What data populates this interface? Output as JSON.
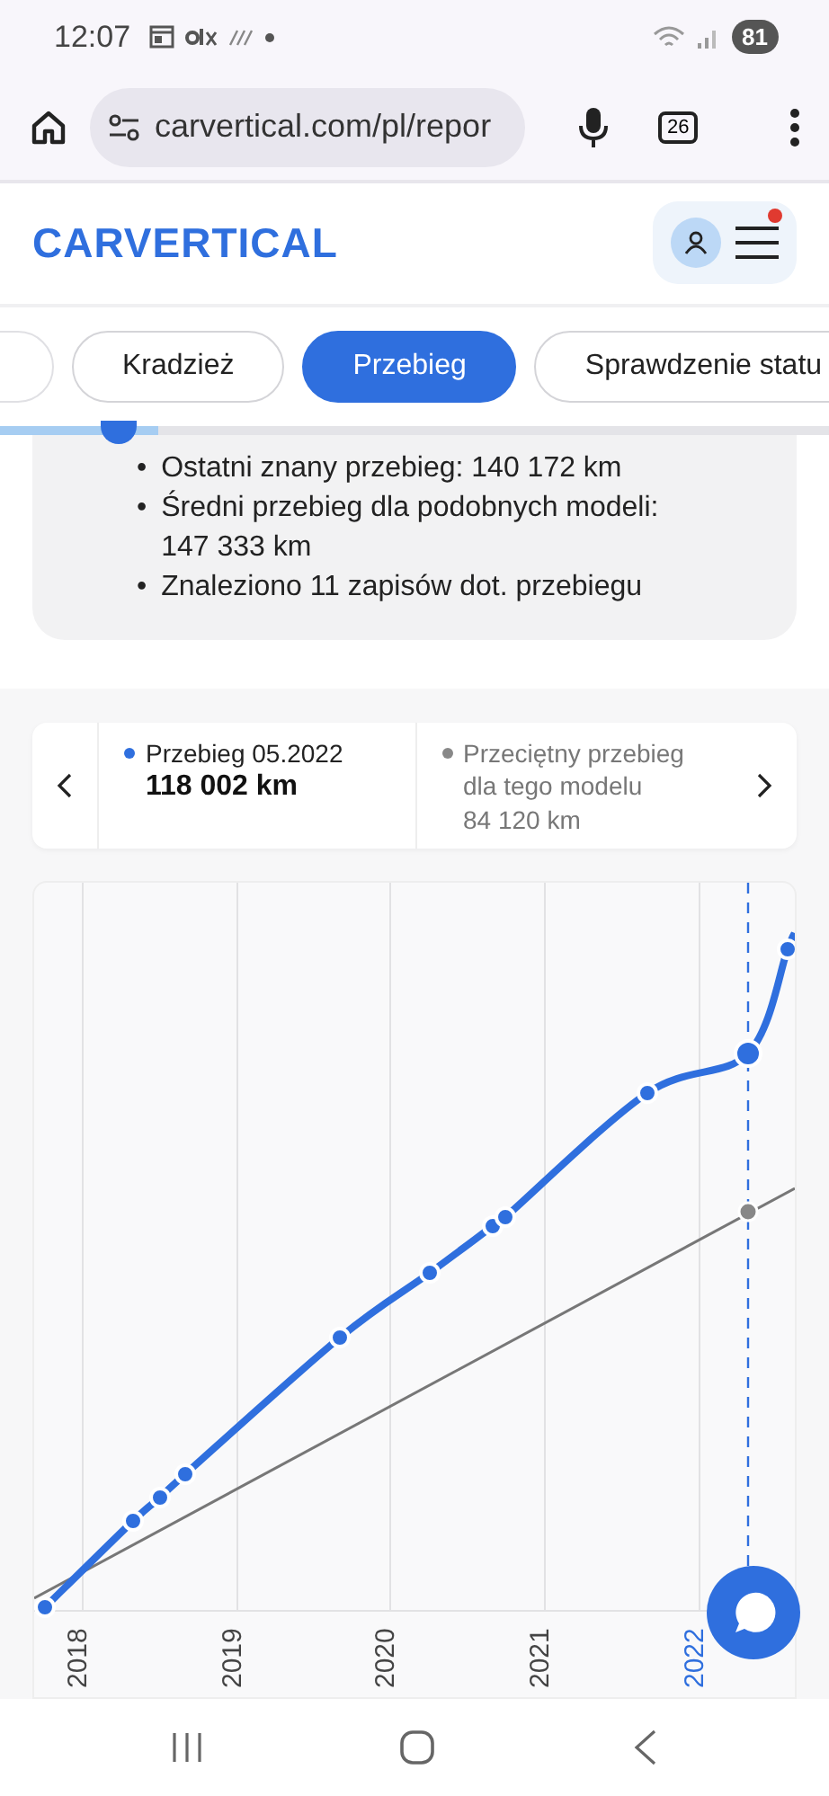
{
  "status_bar": {
    "time": "12:07",
    "battery": "81"
  },
  "browser": {
    "url": "carvertical.com/pl/repor",
    "tab_count": "26"
  },
  "header": {
    "logo": "CARVERTICAL",
    "menu_notification": true
  },
  "tabs": [
    {
      "label": "Kradzież",
      "selected": false
    },
    {
      "label": "Przebieg",
      "selected": true
    },
    {
      "label": "Sprawdzenie statu",
      "selected": false
    }
  ],
  "scroll_progress": {
    "level": 0.19
  },
  "summary": {
    "items": [
      {
        "marker": "•",
        "text": "Ostatni znany przebieg: 140 172 km"
      },
      {
        "marker": "•",
        "text": "Średni przebieg dla podobnych modeli: 147 333 km"
      },
      {
        "marker": "•",
        "text": "Znaleziono 11 zapisów dot. przebiegu"
      }
    ]
  },
  "legend": {
    "items": [
      {
        "kind": "bold",
        "title": "Przebieg 05.2022",
        "value": "118 002 km",
        "color": "#2f6fde"
      },
      {
        "kind": "plain",
        "title": "Przeciętny przebieg dla tego modelu",
        "value": "84 120 km",
        "color": "#888888"
      }
    ]
  },
  "chart": {
    "years": [
      {
        "label": "2018",
        "selected": false
      },
      {
        "label": "2019",
        "selected": false
      },
      {
        "label": "2020",
        "selected": false
      },
      {
        "label": "2021",
        "selected": false
      },
      {
        "label": "2022",
        "selected": true
      }
    ]
  }
}
